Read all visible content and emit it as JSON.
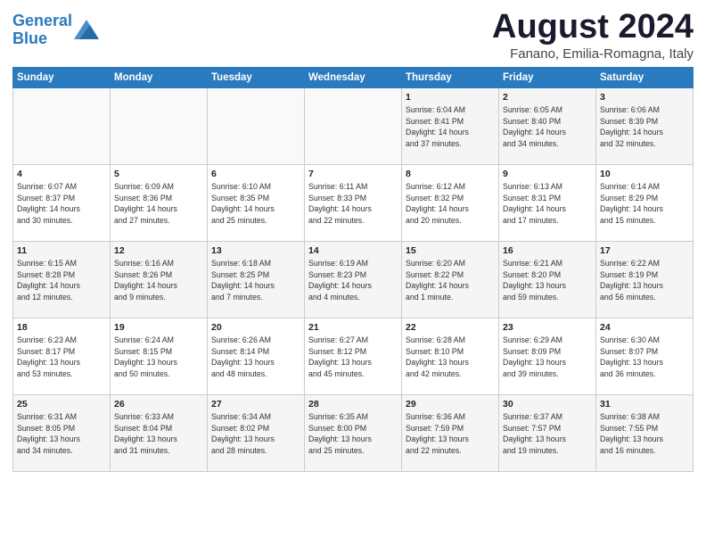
{
  "header": {
    "logo_line1": "General",
    "logo_line2": "Blue",
    "month_title": "August 2024",
    "location": "Fanano, Emilia-Romagna, Italy"
  },
  "weekdays": [
    "Sunday",
    "Monday",
    "Tuesday",
    "Wednesday",
    "Thursday",
    "Friday",
    "Saturday"
  ],
  "weeks": [
    [
      {
        "day": "",
        "info": ""
      },
      {
        "day": "",
        "info": ""
      },
      {
        "day": "",
        "info": ""
      },
      {
        "day": "",
        "info": ""
      },
      {
        "day": "1",
        "info": "Sunrise: 6:04 AM\nSunset: 8:41 PM\nDaylight: 14 hours\nand 37 minutes."
      },
      {
        "day": "2",
        "info": "Sunrise: 6:05 AM\nSunset: 8:40 PM\nDaylight: 14 hours\nand 34 minutes."
      },
      {
        "day": "3",
        "info": "Sunrise: 6:06 AM\nSunset: 8:39 PM\nDaylight: 14 hours\nand 32 minutes."
      }
    ],
    [
      {
        "day": "4",
        "info": "Sunrise: 6:07 AM\nSunset: 8:37 PM\nDaylight: 14 hours\nand 30 minutes."
      },
      {
        "day": "5",
        "info": "Sunrise: 6:09 AM\nSunset: 8:36 PM\nDaylight: 14 hours\nand 27 minutes."
      },
      {
        "day": "6",
        "info": "Sunrise: 6:10 AM\nSunset: 8:35 PM\nDaylight: 14 hours\nand 25 minutes."
      },
      {
        "day": "7",
        "info": "Sunrise: 6:11 AM\nSunset: 8:33 PM\nDaylight: 14 hours\nand 22 minutes."
      },
      {
        "day": "8",
        "info": "Sunrise: 6:12 AM\nSunset: 8:32 PM\nDaylight: 14 hours\nand 20 minutes."
      },
      {
        "day": "9",
        "info": "Sunrise: 6:13 AM\nSunset: 8:31 PM\nDaylight: 14 hours\nand 17 minutes."
      },
      {
        "day": "10",
        "info": "Sunrise: 6:14 AM\nSunset: 8:29 PM\nDaylight: 14 hours\nand 15 minutes."
      }
    ],
    [
      {
        "day": "11",
        "info": "Sunrise: 6:15 AM\nSunset: 8:28 PM\nDaylight: 14 hours\nand 12 minutes."
      },
      {
        "day": "12",
        "info": "Sunrise: 6:16 AM\nSunset: 8:26 PM\nDaylight: 14 hours\nand 9 minutes."
      },
      {
        "day": "13",
        "info": "Sunrise: 6:18 AM\nSunset: 8:25 PM\nDaylight: 14 hours\nand 7 minutes."
      },
      {
        "day": "14",
        "info": "Sunrise: 6:19 AM\nSunset: 8:23 PM\nDaylight: 14 hours\nand 4 minutes."
      },
      {
        "day": "15",
        "info": "Sunrise: 6:20 AM\nSunset: 8:22 PM\nDaylight: 14 hours\nand 1 minute."
      },
      {
        "day": "16",
        "info": "Sunrise: 6:21 AM\nSunset: 8:20 PM\nDaylight: 13 hours\nand 59 minutes."
      },
      {
        "day": "17",
        "info": "Sunrise: 6:22 AM\nSunset: 8:19 PM\nDaylight: 13 hours\nand 56 minutes."
      }
    ],
    [
      {
        "day": "18",
        "info": "Sunrise: 6:23 AM\nSunset: 8:17 PM\nDaylight: 13 hours\nand 53 minutes."
      },
      {
        "day": "19",
        "info": "Sunrise: 6:24 AM\nSunset: 8:15 PM\nDaylight: 13 hours\nand 50 minutes."
      },
      {
        "day": "20",
        "info": "Sunrise: 6:26 AM\nSunset: 8:14 PM\nDaylight: 13 hours\nand 48 minutes."
      },
      {
        "day": "21",
        "info": "Sunrise: 6:27 AM\nSunset: 8:12 PM\nDaylight: 13 hours\nand 45 minutes."
      },
      {
        "day": "22",
        "info": "Sunrise: 6:28 AM\nSunset: 8:10 PM\nDaylight: 13 hours\nand 42 minutes."
      },
      {
        "day": "23",
        "info": "Sunrise: 6:29 AM\nSunset: 8:09 PM\nDaylight: 13 hours\nand 39 minutes."
      },
      {
        "day": "24",
        "info": "Sunrise: 6:30 AM\nSunset: 8:07 PM\nDaylight: 13 hours\nand 36 minutes."
      }
    ],
    [
      {
        "day": "25",
        "info": "Sunrise: 6:31 AM\nSunset: 8:05 PM\nDaylight: 13 hours\nand 34 minutes."
      },
      {
        "day": "26",
        "info": "Sunrise: 6:33 AM\nSunset: 8:04 PM\nDaylight: 13 hours\nand 31 minutes."
      },
      {
        "day": "27",
        "info": "Sunrise: 6:34 AM\nSunset: 8:02 PM\nDaylight: 13 hours\nand 28 minutes."
      },
      {
        "day": "28",
        "info": "Sunrise: 6:35 AM\nSunset: 8:00 PM\nDaylight: 13 hours\nand 25 minutes."
      },
      {
        "day": "29",
        "info": "Sunrise: 6:36 AM\nSunset: 7:59 PM\nDaylight: 13 hours\nand 22 minutes."
      },
      {
        "day": "30",
        "info": "Sunrise: 6:37 AM\nSunset: 7:57 PM\nDaylight: 13 hours\nand 19 minutes."
      },
      {
        "day": "31",
        "info": "Sunrise: 6:38 AM\nSunset: 7:55 PM\nDaylight: 13 hours\nand 16 minutes."
      }
    ]
  ]
}
